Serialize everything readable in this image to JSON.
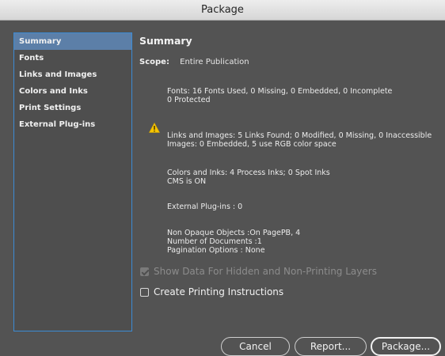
{
  "window": {
    "title": "Package"
  },
  "sidebar": {
    "items": [
      {
        "label": "Summary",
        "selected": true
      },
      {
        "label": "Fonts"
      },
      {
        "label": "Links and Images"
      },
      {
        "label": "Colors and Inks"
      },
      {
        "label": "Print Settings"
      },
      {
        "label": "External Plug-ins"
      }
    ]
  },
  "summary": {
    "title": "Summary",
    "scope_label": "Scope:",
    "scope_value": "Entire Publication",
    "fonts_line1": "Fonts: 16 Fonts Used, 0 Missing, 0 Embedded, 0 Incomplete",
    "fonts_line2": "0 Protected",
    "links_line1": "Links and Images: 5 Links Found; 0 Modified, 0 Missing, 0 Inaccessible",
    "links_line2": "Images: 0 Embedded, 5 use RGB color space",
    "colors_line1": "Colors and Inks: 4 Process Inks; 0 Spot Inks",
    "colors_line2": "CMS is ON",
    "plugins_line1": "External Plug-ins : 0",
    "misc_line1": "Non Opaque Objects :On PagePB, 4",
    "misc_line2": "Number of Documents :1",
    "misc_line3": "Pagination Options : None"
  },
  "options": {
    "show_hidden_label": "Show Data For Hidden and Non-Printing Layers",
    "show_hidden_checked": true,
    "show_hidden_enabled": false,
    "printing_instructions_label": "Create Printing Instructions",
    "printing_instructions_checked": false
  },
  "buttons": {
    "cancel": "Cancel",
    "report": "Report...",
    "package": "Package..."
  },
  "icons": {
    "warning": "warning-triangle-icon"
  },
  "colors": {
    "accent": "#3c8bd4",
    "selected_bg": "#5c7fa8",
    "warning": "#f5c400"
  }
}
